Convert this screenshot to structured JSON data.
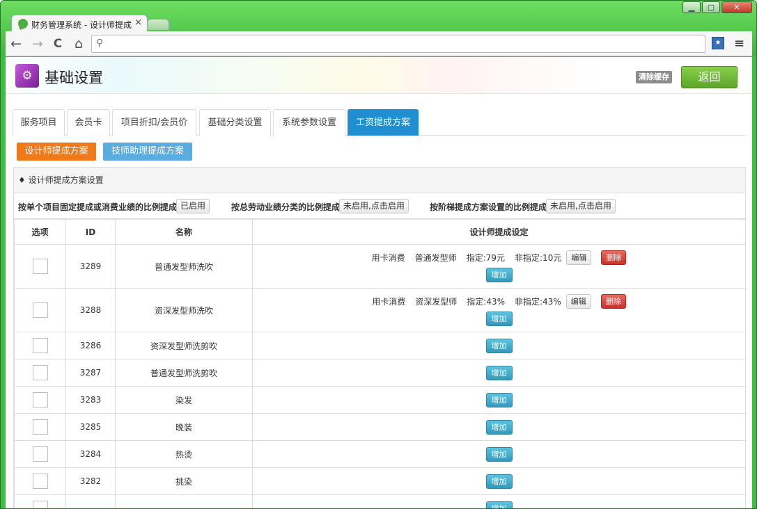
{
  "browser": {
    "tab_title": "财务管理系统 - 设计师提成",
    "tab_close": "×",
    "address_value": "",
    "window_controls": {
      "minimize": "▁",
      "maximize": "▢",
      "close": "✕"
    },
    "icons": {
      "back": "←",
      "forward": "→",
      "reload": "C",
      "home": "⌂",
      "search": "⚲",
      "menu": "≡",
      "bookmark": "★"
    }
  },
  "header": {
    "logo_icon": "⚙",
    "title": "基础设置",
    "clear_cache": "清除缓存",
    "back": "返回"
  },
  "nav_tabs": [
    {
      "label": "服务项目"
    },
    {
      "label": "会员卡"
    },
    {
      "label": "项目折扣/会员价"
    },
    {
      "label": "基础分类设置"
    },
    {
      "label": "系统参数设置"
    },
    {
      "label": "工资提成方案"
    }
  ],
  "sub_buttons": {
    "designer": "设计师提成方案",
    "assistant": "技师助理提成方案"
  },
  "panel": {
    "title": "♦ 设计师提成方案设置",
    "rules": [
      {
        "label": "按单个项目固定提成或消费业绩的比例提成",
        "button": "已启用"
      },
      {
        "label": "按总劳动业绩分类的比例提成",
        "button": "未启用,点击启用"
      },
      {
        "label": "按阶梯提成方案设置的比例提成",
        "button": "未启用,点击启用"
      }
    ]
  },
  "table": {
    "headers": {
      "select": "选项",
      "id": "ID",
      "name": "名称",
      "setting": "设计师提成设定"
    },
    "actions": {
      "edit": "编辑",
      "delete": "删除",
      "add": "增加"
    },
    "rows": [
      {
        "id": "3289",
        "name": "普通发型师洗吹",
        "setting": {
          "type": "用卡消费",
          "level": "普通发型师",
          "assigned": "指定:79元",
          "unassigned": "非指定:10元"
        }
      },
      {
        "id": "3288",
        "name": "资深发型师洗吹",
        "setting": {
          "type": "用卡消费",
          "level": "资深发型师",
          "assigned": "指定:43%",
          "unassigned": "非指定:43%"
        }
      },
      {
        "id": "3286",
        "name": "资深发型师洗剪吹"
      },
      {
        "id": "3287",
        "name": "普通发型师洗剪吹"
      },
      {
        "id": "3283",
        "name": "染发"
      },
      {
        "id": "3285",
        "name": "晚装"
      },
      {
        "id": "3284",
        "name": "热烫"
      },
      {
        "id": "3282",
        "name": "挑染"
      }
    ]
  }
}
